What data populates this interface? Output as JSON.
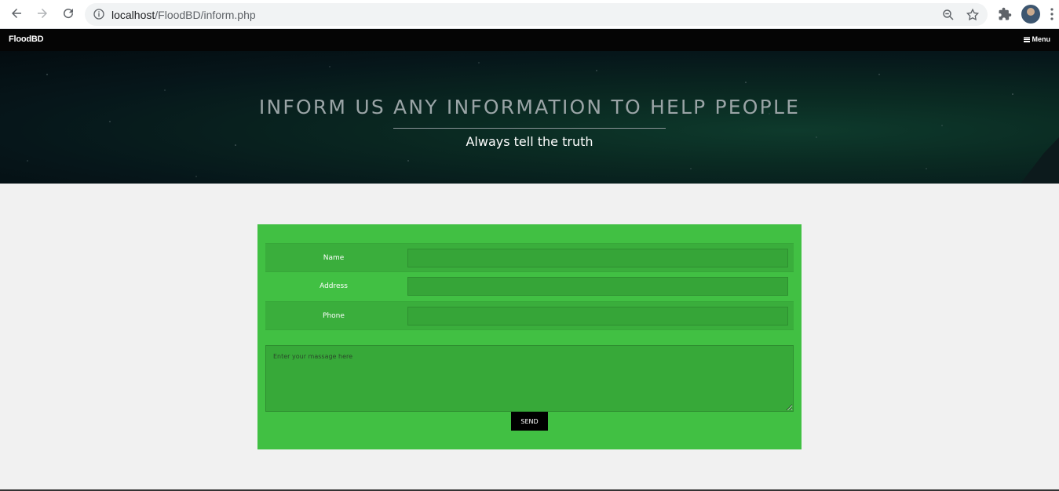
{
  "browser": {
    "url_host": "localhost",
    "url_path": "/FloodBD/inform.php"
  },
  "navbar": {
    "brand": "FloodBD",
    "menu_label": "Menu"
  },
  "hero": {
    "title": "INFORM US ANY INFORMATION TO HELP PEOPLE",
    "subtitle": "Always tell the truth"
  },
  "form": {
    "fields": [
      {
        "label": "Name",
        "value": ""
      },
      {
        "label": "Address",
        "value": ""
      },
      {
        "label": "Phone",
        "value": ""
      }
    ],
    "message_placeholder": "Enter your massage here",
    "send_label": "SEND"
  },
  "colors": {
    "panel": "#41c043",
    "navbar": "#050505"
  }
}
